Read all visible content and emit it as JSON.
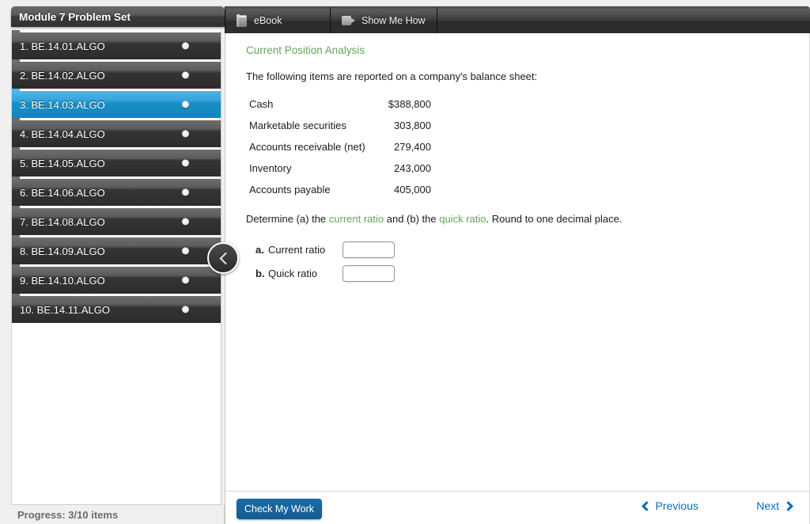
{
  "header": {
    "title": "Module 7 Problem Set"
  },
  "tabs": [
    {
      "label": "eBook",
      "icon": "book-icon"
    },
    {
      "label": "Show Me How",
      "icon": "video-camera-icon"
    }
  ],
  "sidebar": {
    "collapse_icon": "chevron-left-icon",
    "items": [
      {
        "num": "1.",
        "label": "BE.14.01.ALGO",
        "active": false
      },
      {
        "num": "2.",
        "label": "BE.14.02.ALGO",
        "active": false
      },
      {
        "num": "3.",
        "label": "BE.14.03.ALGO",
        "active": true
      },
      {
        "num": "4.",
        "label": "BE.14.04.ALGO",
        "active": false
      },
      {
        "num": "5.",
        "label": "BE.14.05.ALGO",
        "active": false
      },
      {
        "num": "6.",
        "label": "BE.14.06.ALGO",
        "active": false
      },
      {
        "num": "7.",
        "label": "BE.14.08.ALGO",
        "active": false
      },
      {
        "num": "8.",
        "label": "BE.14.09.ALGO",
        "active": false
      },
      {
        "num": "9.",
        "label": "BE.14.10.ALGO",
        "active": false
      },
      {
        "num": "10.",
        "label": "BE.14.11.ALGO",
        "active": false
      }
    ],
    "progress": "Progress:  3/10 items"
  },
  "content": {
    "title": "Current Position Analysis",
    "intro": "The following items are reported on a company's balance sheet:",
    "balance_sheet": [
      {
        "label": "Cash",
        "value": "$388,800"
      },
      {
        "label": "Marketable securities",
        "value": "303,800"
      },
      {
        "label": "Accounts receivable (net)",
        "value": "279,400"
      },
      {
        "label": "Inventory",
        "value": "243,000"
      },
      {
        "label": "Accounts payable",
        "value": "405,000"
      }
    ],
    "determine": {
      "pre": "Determine (a) the ",
      "link1": "current ratio",
      "mid": " and (b) the ",
      "link2": "quick ratio",
      "post": ". Round to one decimal place."
    },
    "answers": [
      {
        "idx": "a.",
        "name": "Current ratio",
        "value": ""
      },
      {
        "idx": "b.",
        "name": "Quick ratio",
        "value": ""
      }
    ]
  },
  "footer": {
    "check_label": "Check My Work",
    "previous_label": "Previous",
    "next_label": "Next"
  },
  "colors": {
    "accent_blue": "#178ec6",
    "link_blue": "#1169b8",
    "button_blue": "#1b6ca8",
    "green": "#64a55c"
  }
}
